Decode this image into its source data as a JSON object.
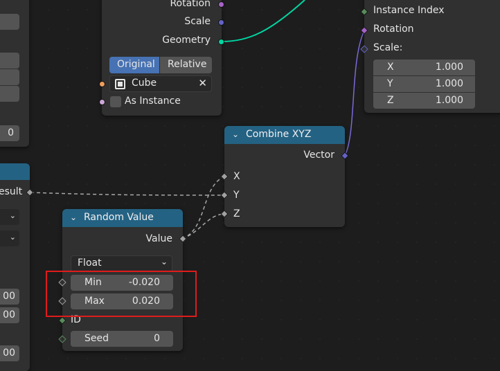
{
  "top_node": {
    "outputs": [
      "Rotation",
      "Scale",
      "Geometry"
    ],
    "toggle": [
      "Original",
      "Relative"
    ],
    "object_value": "Cube",
    "as_instance_label": "As Instance"
  },
  "instance_node": {
    "inputs": [
      "Instance Index",
      "Rotation",
      "Scale:"
    ],
    "scale": [
      {
        "axis": "X",
        "value": "1.000"
      },
      {
        "axis": "Y",
        "value": "1.000"
      },
      {
        "axis": "Z",
        "value": "1.000"
      }
    ]
  },
  "combine_node": {
    "title": "Combine XYZ",
    "output": "Vector",
    "inputs": [
      "X",
      "Y",
      "Z"
    ]
  },
  "random_node": {
    "title": "Random Value",
    "output": "Value",
    "type_value": "Float",
    "min_label": "Min",
    "min_value": "-0.020",
    "max_label": "Max",
    "max_value": "0.020",
    "id_label": "ID",
    "seed_label": "Seed",
    "seed_value": "0"
  },
  "left_node": {
    "result_label": "esult",
    "field_values": [
      "0",
      "00",
      "00",
      "00"
    ]
  },
  "colors": {
    "node_bg": "#303030",
    "header_blue": "#246283",
    "geometry_link": "#00d6a3",
    "vector_socket": "#6363c7",
    "float_socket": "#a1a1a1",
    "integer_socket": "#598c5c",
    "rotation_socket": "#a663c7",
    "object_socket": "#ed9e5c",
    "highlight": "#e01b1b",
    "selected_toggle": "#4772b3"
  }
}
